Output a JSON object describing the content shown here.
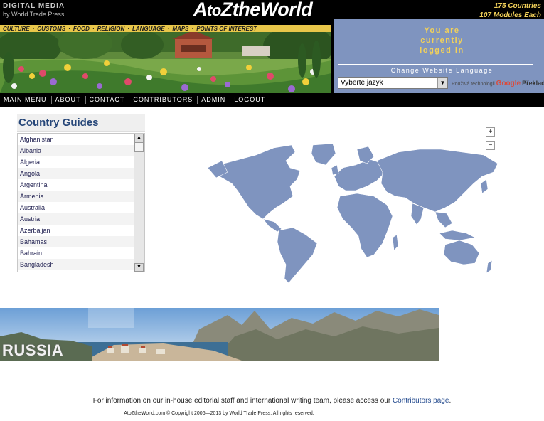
{
  "header": {
    "brand_line1": "DIGITAL MEDIA",
    "brand_line2": "by World Trade Press",
    "logo_a": "A",
    "logo_to": "to",
    "logo_z": "Z",
    "logo_rest": "theWorld",
    "stats_line1": "175 Countries",
    "stats_line2": "107 Modules Each",
    "topics": [
      "CULTURE",
      "CUSTOMS",
      "FOOD",
      "RELIGION",
      "LANGUAGE",
      "MAPS",
      "POINTS OF INTEREST"
    ],
    "login_line1": "You are",
    "login_line2": "currently",
    "login_line3": "logged in",
    "change_language": "Change Website Language",
    "language_select": "Vyberte jazyk",
    "powered_by": "Používá technologii",
    "google": "Google",
    "translate": "Překlad"
  },
  "nav": [
    "MAIN MENU",
    "ABOUT",
    "CONTACT",
    "CONTRIBUTORS",
    "ADMIN",
    "LOGOUT"
  ],
  "country_guides": {
    "title": "Country Guides",
    "items": [
      "Afghanistan",
      "Albania",
      "Algeria",
      "Angola",
      "Argentina",
      "Armenia",
      "Australia",
      "Austria",
      "Azerbaijan",
      "Bahamas",
      "Bahrain",
      "Bangladesh"
    ]
  },
  "map": {
    "zoom_in": "+",
    "zoom_out": "−",
    "land_color": "#7f94bf"
  },
  "banner": {
    "label": "RUSSIA"
  },
  "footer": {
    "info_text": "For information on our in-house editorial staff and international writing team, please access our ",
    "info_link": "Contributors page",
    "info_end": ".",
    "copyright": "AtoZtheWorld.com © Copyright 2006—2013 by World Trade Press. All rights reserved."
  }
}
